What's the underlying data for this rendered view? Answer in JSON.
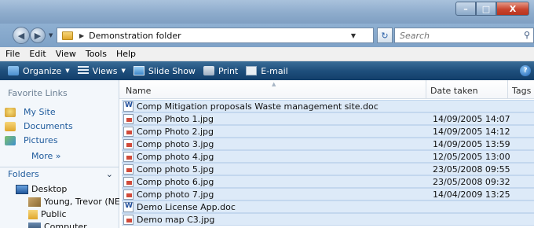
{
  "window": {
    "min_symbol": "–",
    "max_symbol": "□",
    "close_symbol": "X"
  },
  "address": {
    "path": "Demonstration folder",
    "search_placeholder": "Search"
  },
  "menu": [
    "File",
    "Edit",
    "View",
    "Tools",
    "Help"
  ],
  "commands": {
    "organize": "Organize",
    "views": "Views",
    "slideshow": "Slide Show",
    "print": "Print",
    "email": "E-mail"
  },
  "nav": {
    "favorites_header": "Favorite Links",
    "favorites": [
      "My Site",
      "Documents",
      "Pictures"
    ],
    "more": "More »",
    "folders_label": "Folders",
    "tree": [
      "Desktop",
      "Young, Trevor (NE)",
      "Public",
      "Computer"
    ]
  },
  "columns": {
    "name": "Name",
    "date": "Date taken",
    "tags": "Tags"
  },
  "files": [
    {
      "name": "Comp Mitigation proposals Waste management site.doc",
      "date": "",
      "type": "doc"
    },
    {
      "name": "Comp Photo 1.jpg",
      "date": "14/09/2005 14:07",
      "type": "jpg"
    },
    {
      "name": "Comp Photo 2.jpg",
      "date": "14/09/2005 14:12",
      "type": "jpg"
    },
    {
      "name": "Comp photo 3.jpg",
      "date": "14/09/2005 13:59",
      "type": "jpg"
    },
    {
      "name": "Comp photo 4.jpg",
      "date": "12/05/2005 13:00",
      "type": "jpg"
    },
    {
      "name": "Comp photo 5.jpg",
      "date": "23/05/2008 09:55",
      "type": "jpg"
    },
    {
      "name": "Comp photo 6.jpg",
      "date": "23/05/2008 09:32",
      "type": "jpg"
    },
    {
      "name": "Comp photo 7.jpg",
      "date": "14/04/2009 13:25",
      "type": "jpg"
    },
    {
      "name": "Demo License App.doc",
      "date": "",
      "type": "doc"
    },
    {
      "name": "Demo map C3.jpg",
      "date": "",
      "type": "jpg"
    }
  ]
}
